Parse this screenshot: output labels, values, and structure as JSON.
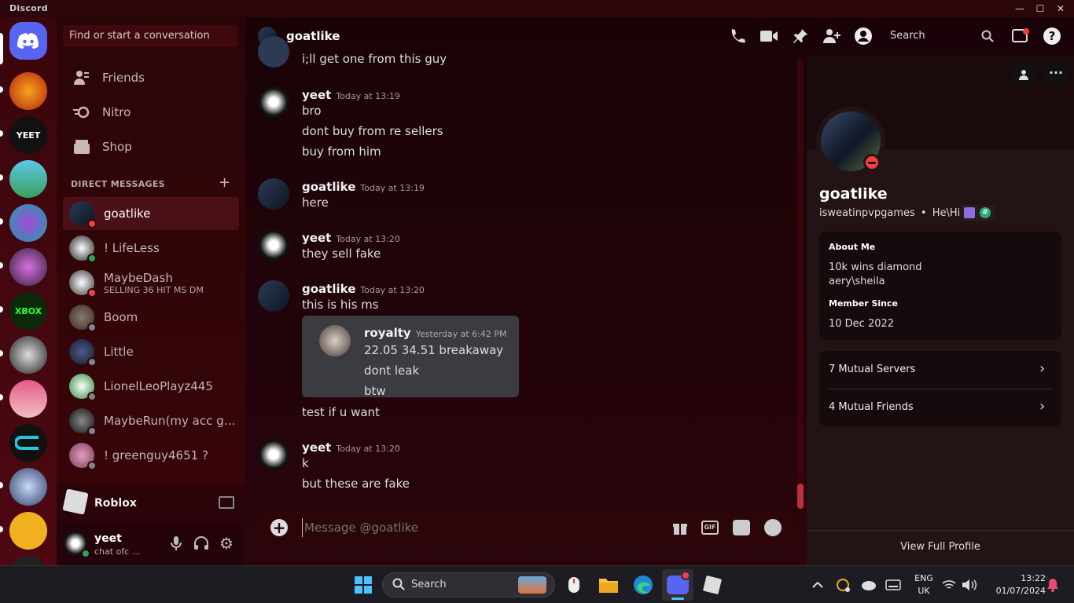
{
  "window": {
    "app_title": "Discord",
    "minimize": "—",
    "maximize": "☐",
    "close": "✕"
  },
  "search_box": {
    "placeholder": "Find or start a conversation"
  },
  "nav": {
    "friends": "Friends",
    "nitro": "Nitro",
    "shop": "Shop"
  },
  "dm_header": {
    "label": "DIRECT MESSAGES",
    "add": "+"
  },
  "dms": [
    {
      "name": "goatlike",
      "status": "dnd"
    },
    {
      "name": "! LifeLess",
      "status": "online"
    },
    {
      "name": "MaybeDash",
      "sub": "SELLING 36 HIT MS DM",
      "status": "dnd"
    },
    {
      "name": "Boom",
      "status": "offline"
    },
    {
      "name": "Little",
      "status": "offline"
    },
    {
      "name": "LionelLeoPlayz445",
      "status": "offline"
    },
    {
      "name": "MaybeRun(my acc got...",
      "status": "offline"
    },
    {
      "name": "! greenguy4651 ?",
      "status": "offline"
    }
  ],
  "activity": {
    "game": "Roblox"
  },
  "user": {
    "name": "yeet",
    "status": "chat ofc ..."
  },
  "chat_header": {
    "name": "goatlike",
    "search": "Search"
  },
  "messages": {
    "cut_line": "i;ll get one from this guy",
    "g1": {
      "author": "yeet",
      "time": "Today at 13:19",
      "lines": [
        "bro",
        "dont buy from re sellers",
        "buy from him"
      ]
    },
    "g2": {
      "author": "goatlike",
      "time": "Today at 13:19",
      "lines": [
        "here"
      ]
    },
    "g3": {
      "author": "yeet",
      "time": "Today at 13:20",
      "lines": [
        "they sell fake"
      ]
    },
    "g4": {
      "author": "goatlike",
      "time": "Today at 13:20",
      "lines": [
        "this is his ms",
        "test if u want"
      ],
      "embed": {
        "author": "royalty",
        "time": "Yesterday at 6:42 PM",
        "lines": [
          "22.05 34.51 breakaway",
          "dont leak",
          "btw"
        ]
      }
    },
    "g5": {
      "author": "yeet",
      "time": "Today at 13:20",
      "lines": [
        "k",
        "but these are fake"
      ]
    }
  },
  "composer": {
    "placeholder": "Message @goatlike",
    "gif": "GIF"
  },
  "profile": {
    "display_name": "goatlike",
    "username": "isweatinpvpgames",
    "pronouns": "He\\Him",
    "about_label": "About Me",
    "about_lines": [
      "10k wins diamond",
      "aery\\sheila"
    ],
    "member_since_label": "Member Since",
    "member_since": "10 Dec 2022",
    "mutual_servers": "7 Mutual Servers",
    "mutual_friends": "4 Mutual Friends",
    "view_full": "View Full Profile"
  },
  "taskbar": {
    "search": "Search",
    "lang": "ENG",
    "region": "UK",
    "time": "13:22",
    "date": "01/07/2024"
  },
  "colors": {
    "accent": "#5865f2",
    "online": "#23a55a",
    "dnd": "#f23f43",
    "offline": "#80848e"
  }
}
